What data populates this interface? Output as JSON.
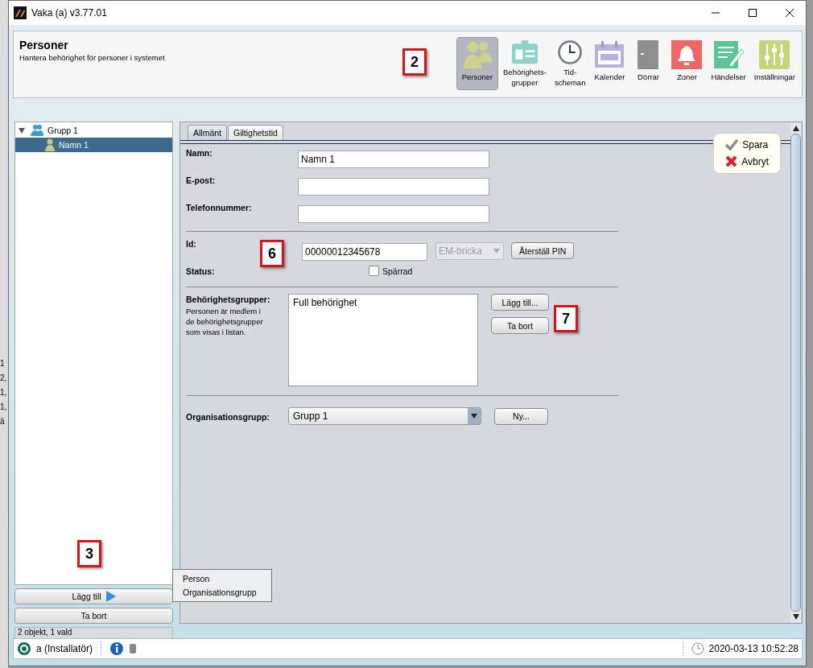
{
  "window": {
    "title": "Vaka (a) v3.77.01"
  },
  "background_window": {
    "fragments": [
      "1",
      "2,",
      "1,",
      "1,",
      "ä"
    ]
  },
  "header": {
    "title": "Personer",
    "subtitle": "Hantera behörighet för personer i systemet"
  },
  "toolbar": [
    {
      "kind": "persons",
      "lines": [
        "Personer"
      ],
      "selected": true
    },
    {
      "kind": "badge",
      "lines": [
        "Behörighets-",
        "grupper"
      ],
      "selected": false
    },
    {
      "kind": "clock",
      "lines": [
        "Tid-",
        "scheman"
      ],
      "selected": false
    },
    {
      "kind": "calendar",
      "lines": [
        "Kalender"
      ],
      "selected": false
    },
    {
      "kind": "door",
      "lines": [
        "Dörrar"
      ],
      "selected": false
    },
    {
      "kind": "zones",
      "lines": [
        "Zoner"
      ],
      "selected": false
    },
    {
      "kind": "events",
      "lines": [
        "Händelser"
      ],
      "selected": false
    },
    {
      "kind": "settings",
      "lines": [
        "Inställningar"
      ],
      "selected": false
    }
  ],
  "callouts": [
    {
      "label": "2"
    },
    {
      "label": "3"
    },
    {
      "label": "6"
    },
    {
      "label": "7"
    }
  ],
  "tree": [
    {
      "label": "Grupp 1",
      "kind": "group",
      "expanded": true,
      "selected": false,
      "children": [
        {
          "label": "Namn 1",
          "kind": "person",
          "selected": true
        }
      ]
    }
  ],
  "left_buttons": [
    {
      "label": "Lägg till",
      "kind": "menu"
    },
    {
      "label": "Ta bort",
      "kind": "plain"
    }
  ],
  "popup_menu": [
    "Person",
    "Organisationsgrupp"
  ],
  "left_status": "2 objekt, 1 vald",
  "tabs": [
    {
      "label": "Allmänt",
      "selected": true
    },
    {
      "label": "Giltighetstid",
      "selected": false
    }
  ],
  "form": {
    "name": {
      "label": "Namn:",
      "value": "Namn 1"
    },
    "email": {
      "label": "E-post:"
    },
    "phone": {
      "label": "Telefonnummer:"
    },
    "id": {
      "label": "Id:",
      "value": "00000012345678",
      "type": {
        "value": "EM-bricka",
        "disabled": true
      },
      "reset_button": "Återställ PIN"
    },
    "status": {
      "label": "Status:",
      "checkbox": {
        "label": "Spärrad",
        "checked": false
      }
    },
    "access_groups": {
      "label": "Behörighetsgrupper:",
      "help": "Personen är medlem i de behörighetsgrupper som visas i listan.",
      "items": [
        "Full behörighet"
      ],
      "buttons": [
        "Lägg till...",
        "Ta bort"
      ]
    },
    "org_group": {
      "label": "Organisationsgrupp:",
      "value": "Grupp 1",
      "button": "Ny..."
    }
  },
  "actions": [
    {
      "label": "Spara",
      "kind": "save"
    },
    {
      "label": "Avbryt",
      "kind": "cancel"
    }
  ],
  "status_bar": {
    "user": "a (Installatör)",
    "datetime": "2020-03-13 10:52:28"
  }
}
